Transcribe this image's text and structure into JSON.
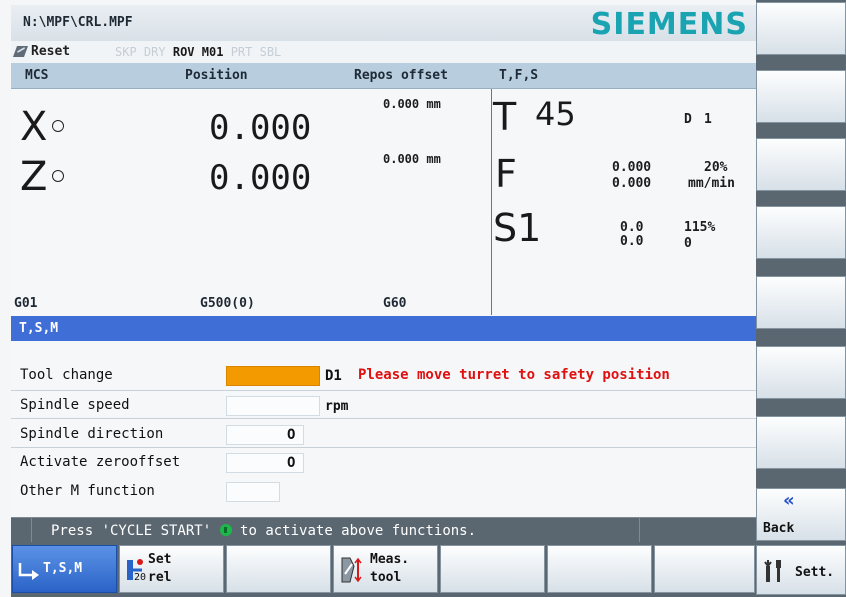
{
  "header": {
    "path": "N:\\MPF\\CRL.MPF",
    "brand": "SIEMENS"
  },
  "status": {
    "reset": "Reset",
    "flags": [
      {
        "text": "SKP",
        "active": false
      },
      {
        "text": "DRY",
        "active": false
      },
      {
        "text": "ROV",
        "active": true
      },
      {
        "text": "M01",
        "active": true
      },
      {
        "text": "PRT",
        "active": false
      },
      {
        "text": "SBL",
        "active": false
      }
    ]
  },
  "columns": {
    "mcs": "MCS",
    "position": "Position",
    "repos": "Repos offset",
    "tfs": "T,F,S"
  },
  "axes": [
    {
      "name": "X",
      "value": "0.000",
      "repos": "0.000 mm"
    },
    {
      "name": "Z",
      "value": "0.000",
      "repos": "0.000 mm"
    }
  ],
  "tfs": {
    "tool_label": "T",
    "tool": "45",
    "d_label": "D",
    "d": "1",
    "feed_label": "F",
    "feed_actual": "0.000",
    "feed_set": "0.000",
    "feed_override": "20%",
    "feed_unit": "mm/min",
    "spindle_label": "S1",
    "spindle_actual": "0.0",
    "spindle_set": "0.0",
    "spindle_override": "115%",
    "spindle_extra": "0"
  },
  "gcodes": [
    "G01",
    "G500(0)",
    "G60"
  ],
  "section_title": "T,S,M",
  "form": {
    "tool_change": {
      "label": "Tool change",
      "value": "",
      "d_value": "D1",
      "message": "Please move turret to safety position"
    },
    "spindle_speed": {
      "label": "Spindle speed",
      "value": "",
      "unit": "rpm"
    },
    "spindle_direction": {
      "label": "Spindle direction",
      "toggle": "O"
    },
    "activate_zero": {
      "label": "Activate zerooffset",
      "toggle": "O"
    },
    "other_m": {
      "label": "Other M function",
      "value": ""
    }
  },
  "message_bar": {
    "prefix": "Press 'CYCLE START'",
    "suffix": "to activate above functions."
  },
  "softkeys_h": {
    "tsm": "T,S,M",
    "set_rel": {
      "line1": "Set",
      "line2": "rel",
      "sub": "20"
    },
    "meas_tool": {
      "line1": "Meas.",
      "line2": "tool"
    }
  },
  "softkeys_v": {
    "back": "Back",
    "sett": "Sett."
  },
  "colors": {
    "accent": "#3f6ed6",
    "active_field": "#f29a00",
    "warning": "#e01010",
    "brand": "#1aa3b1"
  }
}
